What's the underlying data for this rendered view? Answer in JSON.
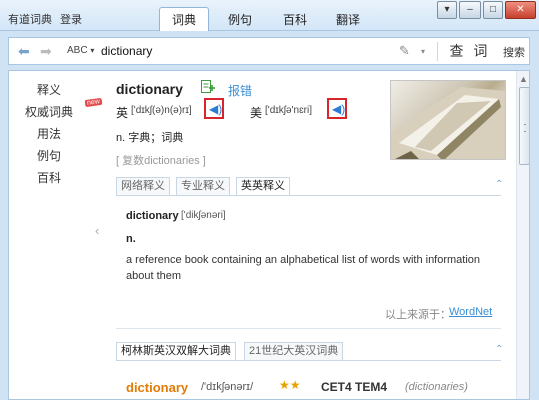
{
  "window": {
    "app_title": "有道词典",
    "login": "登录",
    "tabs": [
      "词典",
      "例句",
      "百科",
      "翻译"
    ],
    "active_tab": "词典"
  },
  "toolbar": {
    "abc_label": "ABC",
    "search_value": "dictionary",
    "search_button": "查 词",
    "other_button": "搜索"
  },
  "sidebar": {
    "items": [
      "释义",
      "权威词典",
      "用法",
      "例句",
      "百科"
    ],
    "new_badge": "new"
  },
  "entry": {
    "word": "dictionary",
    "report": "报错",
    "uk_label": "英",
    "uk_phonetic": "['dɪkʃ(ə)n(ə)rɪ]",
    "us_label": "美",
    "us_phonetic": "['dɪkʃə'nɛri]",
    "meaning": "n. 字典；词典",
    "reviews": "[ 复数dictionaries ]"
  },
  "def_tabs": [
    "网络释义",
    "专业释义",
    "英英释义"
  ],
  "active_def_tab": "英英释义",
  "english_def": {
    "headword": "dictionary",
    "phonetic": "['dikʃənəri]",
    "pos": "n.",
    "definition": "a reference book containing an alphabetical list of words with information about them",
    "source_prefix": "以上来源于：",
    "source_link": "WordNet"
  },
  "dict_tabs": [
    "柯林斯英汉双解大词典",
    "21世纪大英汉词典"
  ],
  "active_dict_tab": "柯林斯英汉双解大词典",
  "collins": {
    "word": "dictionary",
    "phonetic": "/'dɪkʃənərɪ/",
    "stars": "★★",
    "levels": "CET4 TEM4",
    "plural": "(dictionaries)"
  }
}
